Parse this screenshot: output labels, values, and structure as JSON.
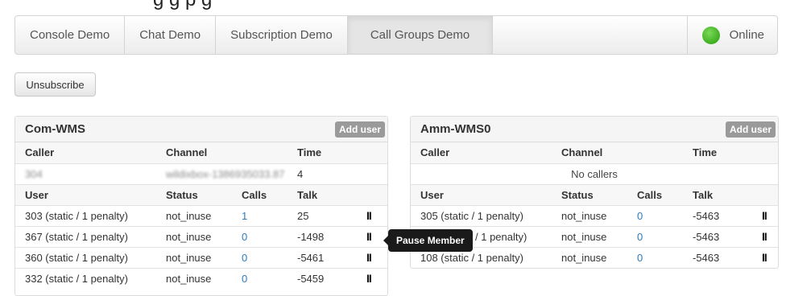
{
  "page": {
    "heading_fragment": "g g p g"
  },
  "nav": {
    "tabs": [
      {
        "label": "Console Demo"
      },
      {
        "label": "Chat Demo"
      },
      {
        "label": "Subscription Demo"
      },
      {
        "label": "Call Groups Demo"
      }
    ],
    "status": "Online",
    "status_color": "#3fae1f"
  },
  "toolbar": {
    "unsubscribe_label": "Unsubscribe"
  },
  "groups": [
    {
      "title": "Com-WMS",
      "add_user_label": "Add user",
      "caller_headers": {
        "caller": "Caller",
        "channel": "Channel",
        "time": "Time"
      },
      "callers": [
        {
          "caller": "304",
          "channel": "wildixbox-1386935033.87",
          "time": "4"
        }
      ],
      "user_headers": {
        "user": "User",
        "status": "Status",
        "calls": "Calls",
        "talk": "Talk"
      },
      "members": [
        {
          "user": "303 (static / 1 penalty)",
          "status": "not_inuse",
          "calls": "1",
          "talk": "25"
        },
        {
          "user": "367 (static / 1 penalty)",
          "status": "not_inuse",
          "calls": "0",
          "talk": "-1498"
        },
        {
          "user": "360 (static / 1 penalty)",
          "status": "not_inuse",
          "calls": "0",
          "talk": "-5461"
        },
        {
          "user": "332 (static / 1 penalty)",
          "status": "not_inuse",
          "calls": "0",
          "talk": "-5459"
        }
      ]
    },
    {
      "title": "Amm-WMS0",
      "add_user_label": "Add user",
      "caller_headers": {
        "caller": "Caller",
        "channel": "Channel",
        "time": "Time"
      },
      "no_callers": "No callers",
      "user_headers": {
        "user": "User",
        "status": "Status",
        "calls": "Calls",
        "talk": "Talk"
      },
      "members": [
        {
          "user": "305 (static / 1 penalty)",
          "status": "not_inuse",
          "calls": "0",
          "talk": "-5463"
        },
        {
          "user": "/ 1 penalty)",
          "status": "not_inuse",
          "calls": "0",
          "talk": "-5463"
        },
        {
          "user": "108 (static / 1 penalty)",
          "status": "not_inuse",
          "calls": "0",
          "talk": "-5463"
        }
      ]
    }
  ],
  "tooltip": {
    "text": "Pause Member"
  },
  "icons": {
    "pause": "pause-icon",
    "status": "online-dot-icon"
  },
  "pause_glyph": "II"
}
